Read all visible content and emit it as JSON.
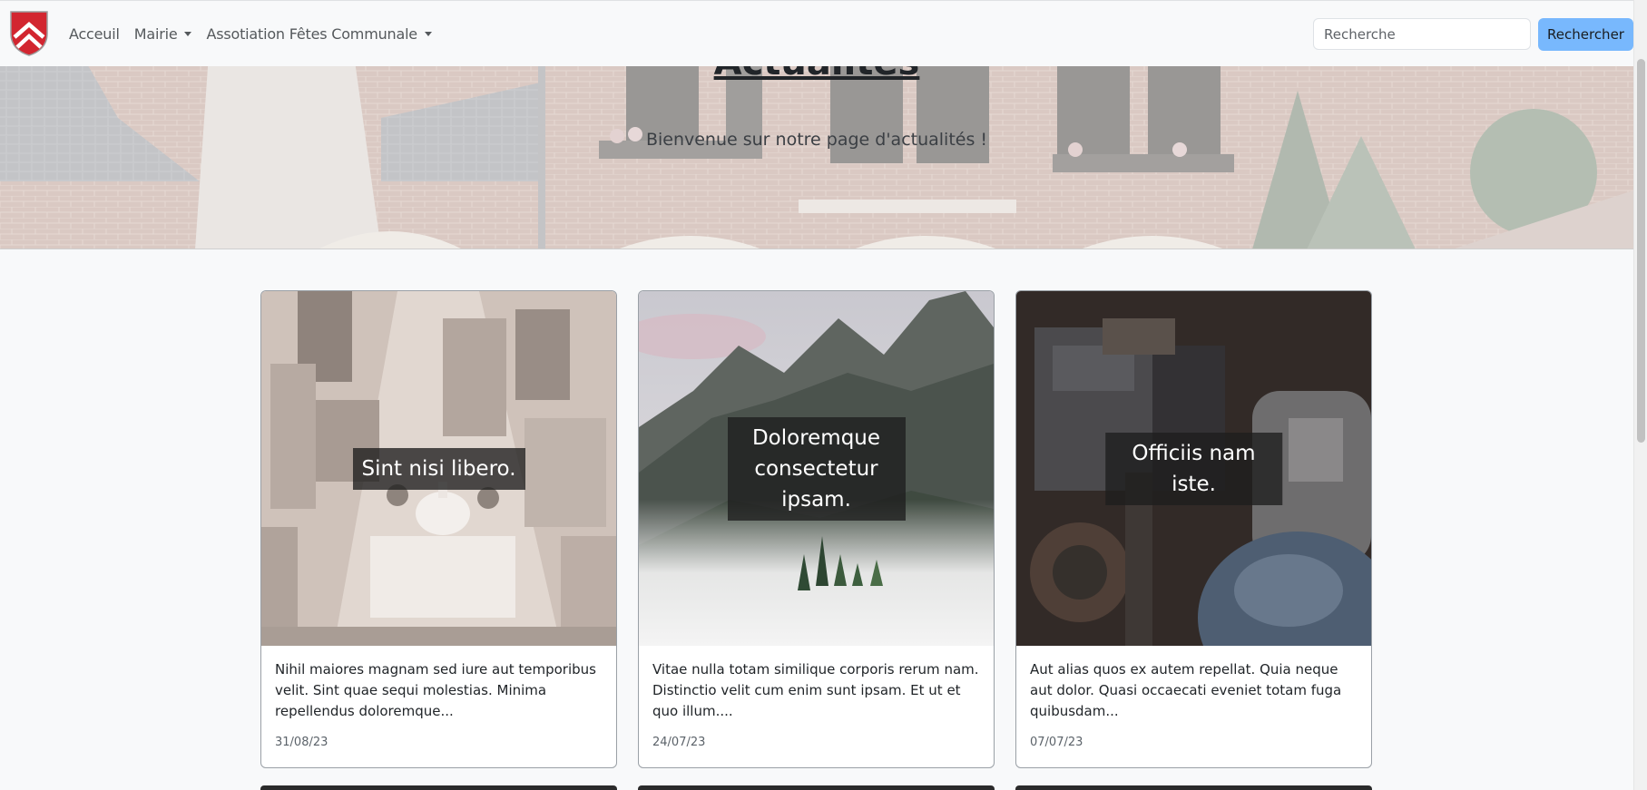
{
  "navbar": {
    "logo_name": "coat-of-arms",
    "links": [
      {
        "label": "Acceuil",
        "dropdown": false
      },
      {
        "label": "Mairie",
        "dropdown": true
      },
      {
        "label": "Assotiation Fêtes Communale",
        "dropdown": true
      }
    ],
    "search": {
      "placeholder": "Recherche",
      "value": "",
      "button_label": "Rechercher"
    },
    "colors": {
      "search_button": "#78b8fd",
      "logo_red": "#d22630"
    }
  },
  "hero": {
    "title": "Actualités",
    "subtitle": "Bienvenue sur notre page d'actualités !"
  },
  "cards": [
    {
      "overlay_title": "Sint nisi libero.",
      "excerpt": "Nihil maiores magnam sed iure aut temporibus velit. Sint quae sequi molestias. Minima repellendus doloremque...",
      "date": "31/08/23",
      "image": "city-aerial"
    },
    {
      "overlay_title": "Doloremque consectetur ipsam.",
      "excerpt": "Vitae nulla totam similique corporis rerum nam. Distinctio velit cum enim sunt ipsam. Et ut et quo illum....",
      "date": "24/07/23",
      "image": "mountain-mist"
    },
    {
      "overlay_title": "Officiis nam iste.",
      "excerpt": "Aut alias quos ex autem repellat. Quia neque aut dolor. Quasi occaecati eveniet totam fuga quibusdam...",
      "date": "07/07/23",
      "image": "old-machinery"
    }
  ]
}
